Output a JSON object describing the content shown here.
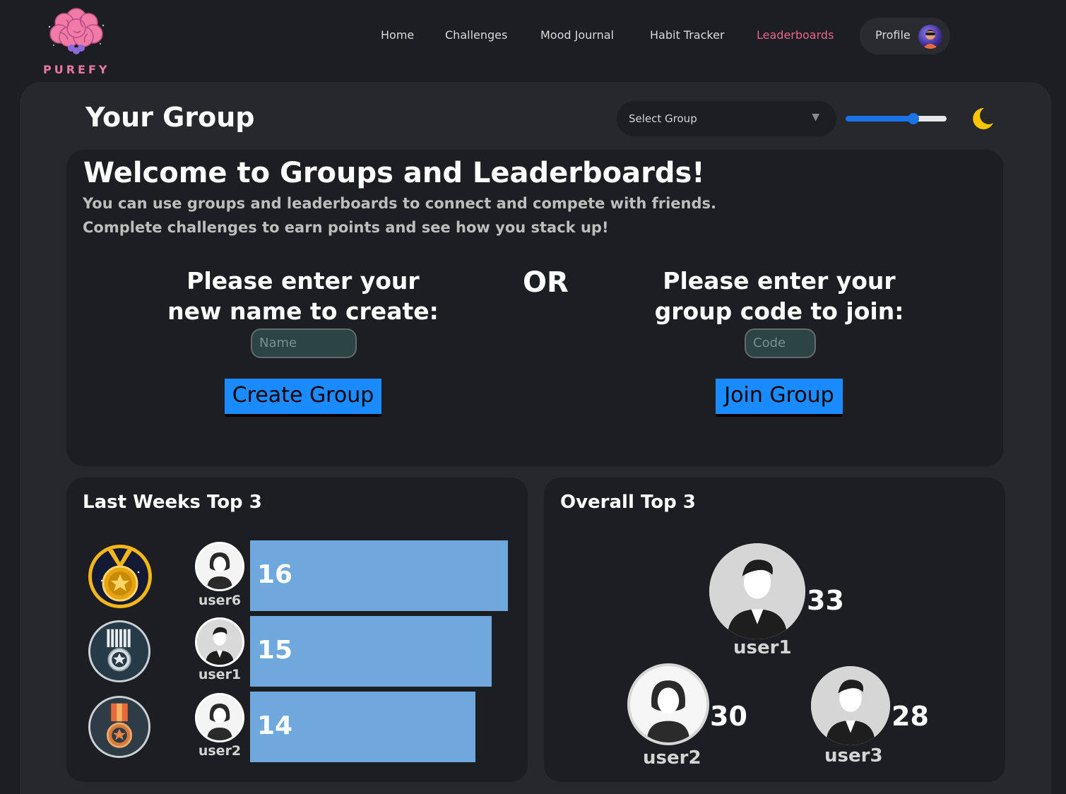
{
  "brand": {
    "name": "PUREFY",
    "logo_icon": "brain-icon"
  },
  "nav": {
    "items": [
      {
        "label": "Home",
        "active": false
      },
      {
        "label": "Challenges",
        "active": false
      },
      {
        "label": "Mood Journal",
        "active": false
      },
      {
        "label": "Habit Tracker",
        "active": false
      },
      {
        "label": "Leaderboards",
        "active": true
      }
    ],
    "profile_label": "Profile",
    "active_color": "#e8658f"
  },
  "header": {
    "title": "Your Group",
    "select_placeholder": "Select Group",
    "slider_value_fraction": 0.68,
    "theme_icon": "moon-icon"
  },
  "welcome": {
    "title": "Welcome to Groups and Leaderboards!",
    "line1": "You can use groups and leaderboards to connect and compete with friends.",
    "line2": "Complete challenges to earn points and see how you stack up!",
    "create_prompt_line1": "Please enter your",
    "create_prompt_line2": "new name to create:",
    "or_text": "OR",
    "join_prompt_line1": "Please enter your",
    "join_prompt_line2": "group code to join:",
    "name_placeholder": "Name",
    "code_placeholder": "Code",
    "create_button": "Create Group",
    "join_button": "Join Group"
  },
  "last_week": {
    "title": "Last Weeks Top 3",
    "entries": [
      {
        "rank": 1,
        "medal": "gold-medal-icon",
        "user": "user6",
        "score": "16",
        "avatar": "female"
      },
      {
        "rank": 2,
        "medal": "silver-medal-icon",
        "user": "user1",
        "score": "15",
        "avatar": "male"
      },
      {
        "rank": 3,
        "medal": "bronze-medal-icon",
        "user": "user2",
        "score": "14",
        "avatar": "female"
      }
    ]
  },
  "overall": {
    "title": "Overall Top 3",
    "entries": [
      {
        "rank": 1,
        "user": "user1",
        "score": "33",
        "avatar": "male"
      },
      {
        "rank": 2,
        "user": "user2",
        "score": "30",
        "avatar": "female"
      },
      {
        "rank": 3,
        "user": "user3",
        "score": "28",
        "avatar": "male"
      }
    ]
  },
  "colors": {
    "bar": "#6fa8dc",
    "button": "#1a8cff",
    "brand": "#e879a6"
  }
}
